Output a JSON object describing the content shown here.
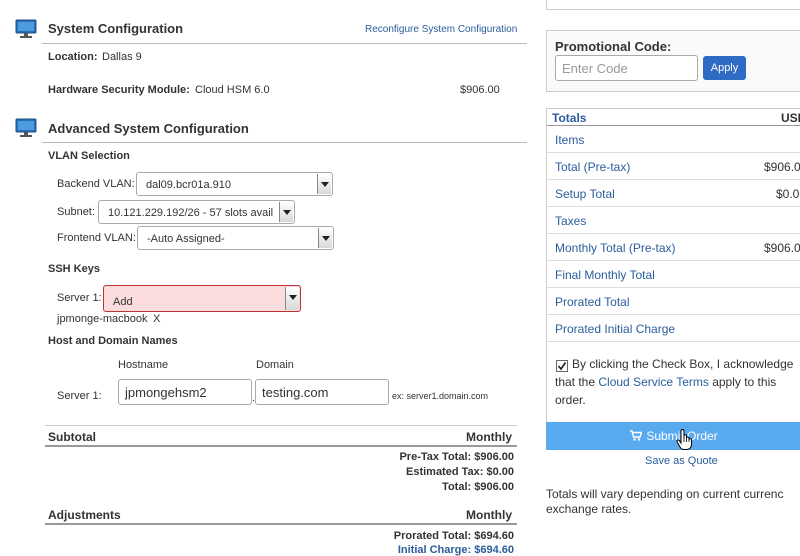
{
  "system_config": {
    "title": "System Configuration",
    "reconfigure_link": "Reconfigure System Configuration",
    "location_label": "Location:",
    "location_value": "Dallas 9",
    "hsm_label": "Hardware Security Module:",
    "hsm_value": "Cloud HSM 6.0",
    "hsm_price": "$906.00"
  },
  "advanced": {
    "title": "Advanced System Configuration",
    "vlan_heading": "VLAN Selection",
    "backend_label": "Backend VLAN:",
    "backend_value": "dal09.bcr01a.910",
    "subnet_label": "Subnet:",
    "subnet_value": "10.121.229.192/26 - 57 slots avail",
    "frontend_label": "Frontend VLAN:",
    "frontend_value": "-Auto Assigned-",
    "ssh_heading": "SSH Keys",
    "ssh_server_label": "Server 1:",
    "ssh_select_value": "Add",
    "ssh_key_name": "jpmonge-macbook",
    "ssh_key_remove": "X",
    "host_heading": "Host and Domain Names",
    "hostname_col": "Hostname",
    "domain_col": "Domain",
    "host_server_label": "Server 1:",
    "hostname_value": "jpmongehsm2",
    "domain_value": "testing.com",
    "domain_example": "ex: server1.domain.com",
    "dot": "."
  },
  "subtotal": {
    "title": "Subtotal",
    "col": "Monthly",
    "pretax": "Pre-Tax Total: $906.00",
    "tax": "Estimated Tax: $0.00",
    "total": "Total: $906.00"
  },
  "adjustments": {
    "title": "Adjustments",
    "col": "Monthly",
    "prorated": "Prorated Total: $694.60",
    "initial": "Initial Charge: $694.60"
  },
  "promo": {
    "label": "Promotional Code:",
    "placeholder": "Enter Code",
    "apply": "Apply"
  },
  "totals": {
    "title": "Totals",
    "currency": "USD",
    "rows": [
      {
        "label": "Items",
        "value": ""
      },
      {
        "label": "Total (Pre-tax)",
        "value": "$906.0"
      },
      {
        "label": "Setup Total",
        "value": "$0.0"
      },
      {
        "label": "Taxes",
        "value": ""
      },
      {
        "label": "Monthly Total (Pre-tax)",
        "value": "$906.0"
      },
      {
        "label": "Final Monthly Total",
        "value": ""
      },
      {
        "label": "Prorated Total",
        "value": ""
      },
      {
        "label": "Prorated Initial Charge",
        "value": ""
      }
    ],
    "agree_text_1": "By clicking the Check Box, I acknowledge",
    "agree_text_2a": "that the ",
    "agree_link": "Cloud Service Terms",
    "agree_text_2b": " apply to this",
    "agree_text_3": "order.",
    "agree_checked": true
  },
  "submit_label": "Submit Order",
  "save_quote": "Save as Quote",
  "footnote_1": "Totals will vary depending on current currenc",
  "footnote_2": "exchange rates."
}
